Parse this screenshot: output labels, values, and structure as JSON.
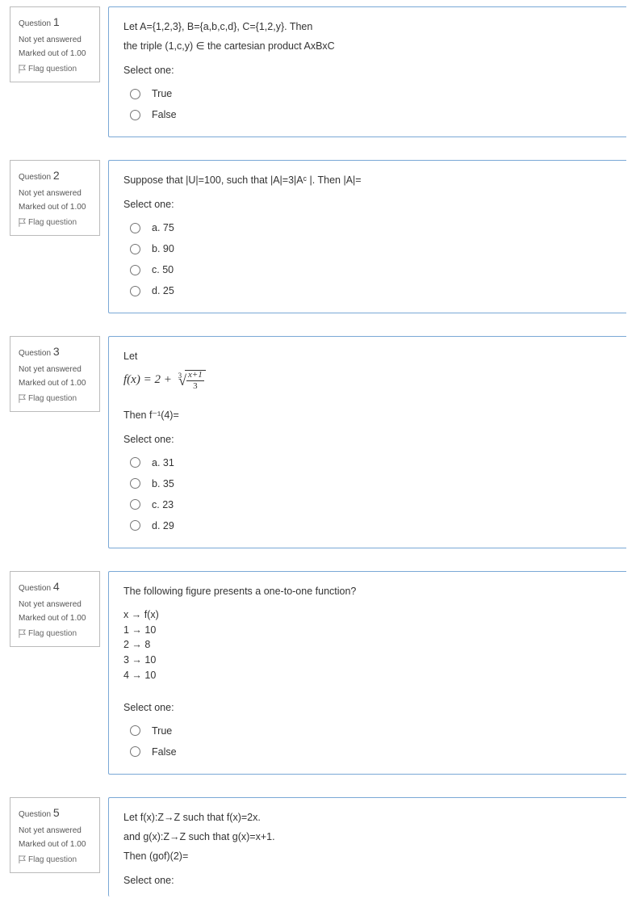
{
  "common": {
    "question_label": "Question",
    "status": "Not yet answered",
    "marks": "Marked out of 1.00",
    "flag": "Flag question",
    "select_one": "Select one:"
  },
  "questions": [
    {
      "num": "1",
      "text_lines": [
        "Let A={1,2,3}, B={a,b,c,d}, C={1,2,y}. Then",
        "the triple (1,c,y) ∈ the cartesian product AxBxC"
      ],
      "options": [
        "True",
        "False"
      ]
    },
    {
      "num": "2",
      "text_lines": [
        "Suppose that |U|=100, such that |A|=3|Aᶜ |. Then |A|="
      ],
      "options": [
        "a. 75",
        "b. 90",
        "c. 50",
        "d. 25"
      ]
    },
    {
      "num": "3",
      "pre_text": "Let",
      "formula_prefix": "f(x) = 2 + ",
      "formula_root_index": "3",
      "formula_num": "x+1",
      "formula_den": "3",
      "post_text": "Then f⁻¹(4)=",
      "options": [
        "a. 31",
        "b. 35",
        "c. 23",
        "d. 29"
      ]
    },
    {
      "num": "4",
      "text_lines": [
        "The following figure presents a one-to-one function?"
      ],
      "mapping": [
        "x → f(x)",
        "1 → 10",
        "2 → 8",
        "3 → 10",
        "4 → 10"
      ],
      "options": [
        "True",
        "False"
      ]
    },
    {
      "num": "5",
      "text_lines": [
        "Let f(x):Z→Z such that f(x)=2x.",
        "and g(x):Z→Z such that g(x)=x+1.",
        "Then (gof)(2)="
      ]
    }
  ]
}
